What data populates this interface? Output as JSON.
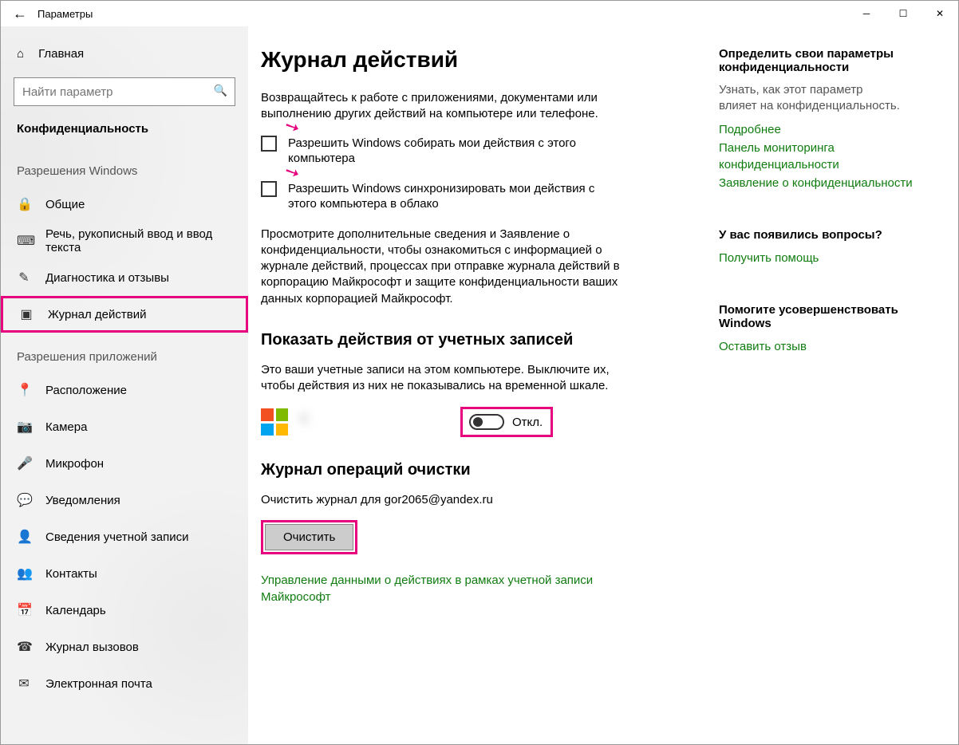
{
  "titlebar": {
    "title": "Параметры"
  },
  "sidebar": {
    "home": "Главная",
    "search_placeholder": "Найти параметр",
    "category": "Конфиденциальность",
    "group1_header": "Разрешения Windows",
    "group1": [
      {
        "label": "Общие"
      },
      {
        "label": "Речь, рукописный ввод и ввод текста"
      },
      {
        "label": "Диагностика и отзывы"
      },
      {
        "label": "Журнал действий"
      }
    ],
    "group2_header": "Разрешения приложений",
    "group2": [
      {
        "label": "Расположение"
      },
      {
        "label": "Камера"
      },
      {
        "label": "Микрофон"
      },
      {
        "label": "Уведомления"
      },
      {
        "label": "Сведения учетной записи"
      },
      {
        "label": "Контакты"
      },
      {
        "label": "Календарь"
      },
      {
        "label": "Журнал вызовов"
      },
      {
        "label": "Электронная почта"
      }
    ]
  },
  "main": {
    "heading": "Журнал действий",
    "intro": "Возвращайтесь к работе с приложениями, документами или выполнению других действий на компьютере или телефоне.",
    "cb1": "Разрешить Windows собирать мои действия с этого компьютера",
    "cb2": "Разрешить Windows синхронизировать мои действия с этого компьютера в облако",
    "longp": "Просмотрите дополнительные сведения и Заявление о конфиденциальности, чтобы ознакомиться с информацией о журнале действий, процессах при отправке журнала действий в корпорацию Майкрософт и защите конфиденциальности ваших данных корпорацией Майкрософт.",
    "accounts_heading": "Показать действия от учетных записей",
    "accounts_intro": "Это ваши учетные записи на этом компьютере. Выключите их, чтобы действия из них не показывались на временной шкале.",
    "toggle_label": "Откл.",
    "clear_heading": "Журнал операций очистки",
    "clear_text": "Очистить журнал для gor2065@yandex.ru",
    "clear_button": "Очистить",
    "manage_link": "Управление данными о действиях в рамках учетной записи Майкрософт"
  },
  "right": {
    "block1_title": "Определить свои параметры конфиденциальности",
    "block1_text": "Узнать, как этот параметр влияет на конфиденциальность.",
    "block1_links": [
      "Подробнее",
      "Панель мониторинга конфиденциальности",
      "Заявление о конфиденциальности"
    ],
    "block2_title": "У вас появились вопросы?",
    "block2_link": "Получить помощь",
    "block3_title": "Помогите усовершенствовать Windows",
    "block3_link": "Оставить отзыв"
  }
}
